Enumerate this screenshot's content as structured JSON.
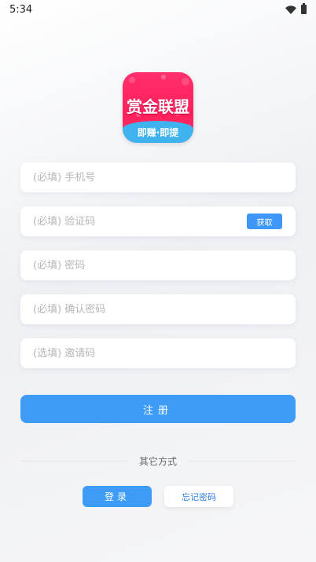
{
  "status_bar": {
    "time": "5:34",
    "icons": [
      "wifi-icon",
      "battery-icon"
    ]
  },
  "logo": {
    "title": "赏金联盟",
    "subtitle": "即赚·即提"
  },
  "form": {
    "phone": {
      "placeholder": "(必填) 手机号",
      "value": ""
    },
    "code": {
      "placeholder": "(必填) 验证码",
      "value": "",
      "button_label": "获取"
    },
    "password": {
      "placeholder": "(必填) 密码",
      "value": ""
    },
    "confirm_password": {
      "placeholder": "(必填) 确认密码",
      "value": ""
    },
    "invite_code": {
      "placeholder": "(选填) 邀请码",
      "value": ""
    }
  },
  "register_label": "注册",
  "other_methods_label": "其它方式",
  "login_label": "登录",
  "forgot_password_label": "忘记密码",
  "colors": {
    "primary": "#3e9cf7",
    "logo_pink": "#ff2f6d",
    "logo_banner": "#3fb3ef",
    "placeholder": "#b6b6bb"
  }
}
